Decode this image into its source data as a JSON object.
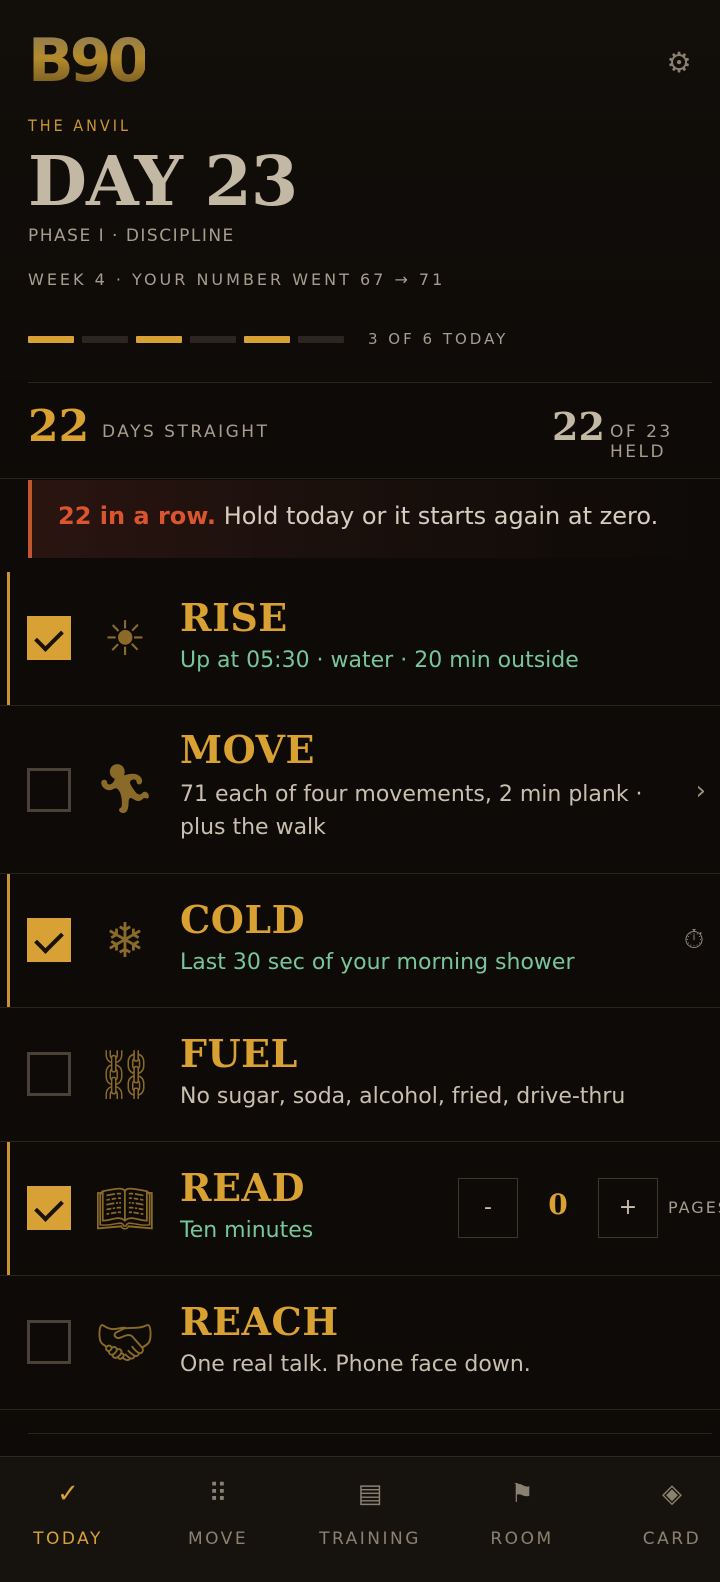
{
  "header": {
    "logo": "B90",
    "kicker": "THE ANVIL",
    "day_title": "DAY 23",
    "phase": "PHASE I · DISCIPLINE",
    "week_line": "WEEK 4 · YOUR NUMBER WENT 67 → 71",
    "progress": {
      "done": 3,
      "total": 6,
      "label": "3 OF 6 TODAY",
      "segments": [
        true,
        false,
        true,
        false,
        true,
        false
      ]
    }
  },
  "stats": {
    "streak_value": "22",
    "streak_label": "DAYS STRAIGHT",
    "held_value": "22",
    "held_label": "OF 23 HELD"
  },
  "banner": {
    "strong": "22 in a row.",
    "text": " Hold today or it starts again at zero."
  },
  "tasks": [
    {
      "title": "RISE",
      "subtitle": "Up at 05:30 · water · 20 min outside",
      "checked": true,
      "icon": "sun-icon"
    },
    {
      "title": "MOVE",
      "subtitle_line1": "71 each of four movements, 2 min plank ·",
      "subtitle_line2": "plus the walk",
      "checked": false,
      "icon": "runner-icon"
    },
    {
      "title": "COLD",
      "subtitle": "Last 30 sec of your morning shower",
      "checked": true,
      "icon": "snowflake-icon"
    },
    {
      "title": "FUEL",
      "subtitle": "No sugar, soda, alcohol, fried, drive-thru",
      "checked": false,
      "icon": "chain-icon"
    },
    {
      "title": "READ",
      "subtitle": "Ten minutes",
      "checked": true,
      "icon": "book-icon",
      "stepper": {
        "minus": "-",
        "value": "0",
        "plus": "+",
        "unit": "PAGES"
      }
    },
    {
      "title": "REACH",
      "subtitle": "One real talk. Phone face down.",
      "checked": false,
      "icon": "handshake-icon"
    }
  ],
  "nav": [
    {
      "label": "TODAY",
      "icon": "check-icon",
      "glyph": "✓",
      "active": true
    },
    {
      "label": "MOVE",
      "icon": "grid-icon",
      "glyph": "⠿",
      "active": false
    },
    {
      "label": "TRAINING",
      "icon": "list-icon",
      "glyph": "▤",
      "active": false
    },
    {
      "label": "ROOM",
      "icon": "flag-icon",
      "glyph": "⚑",
      "active": false
    },
    {
      "label": "CARD",
      "icon": "diamond-icon",
      "glyph": "◈",
      "active": false
    }
  ],
  "colors": {
    "accent": "#d8a136",
    "streak_red": "#d9552f",
    "green_sub": "#79c59a",
    "background": "#0d0a07"
  }
}
